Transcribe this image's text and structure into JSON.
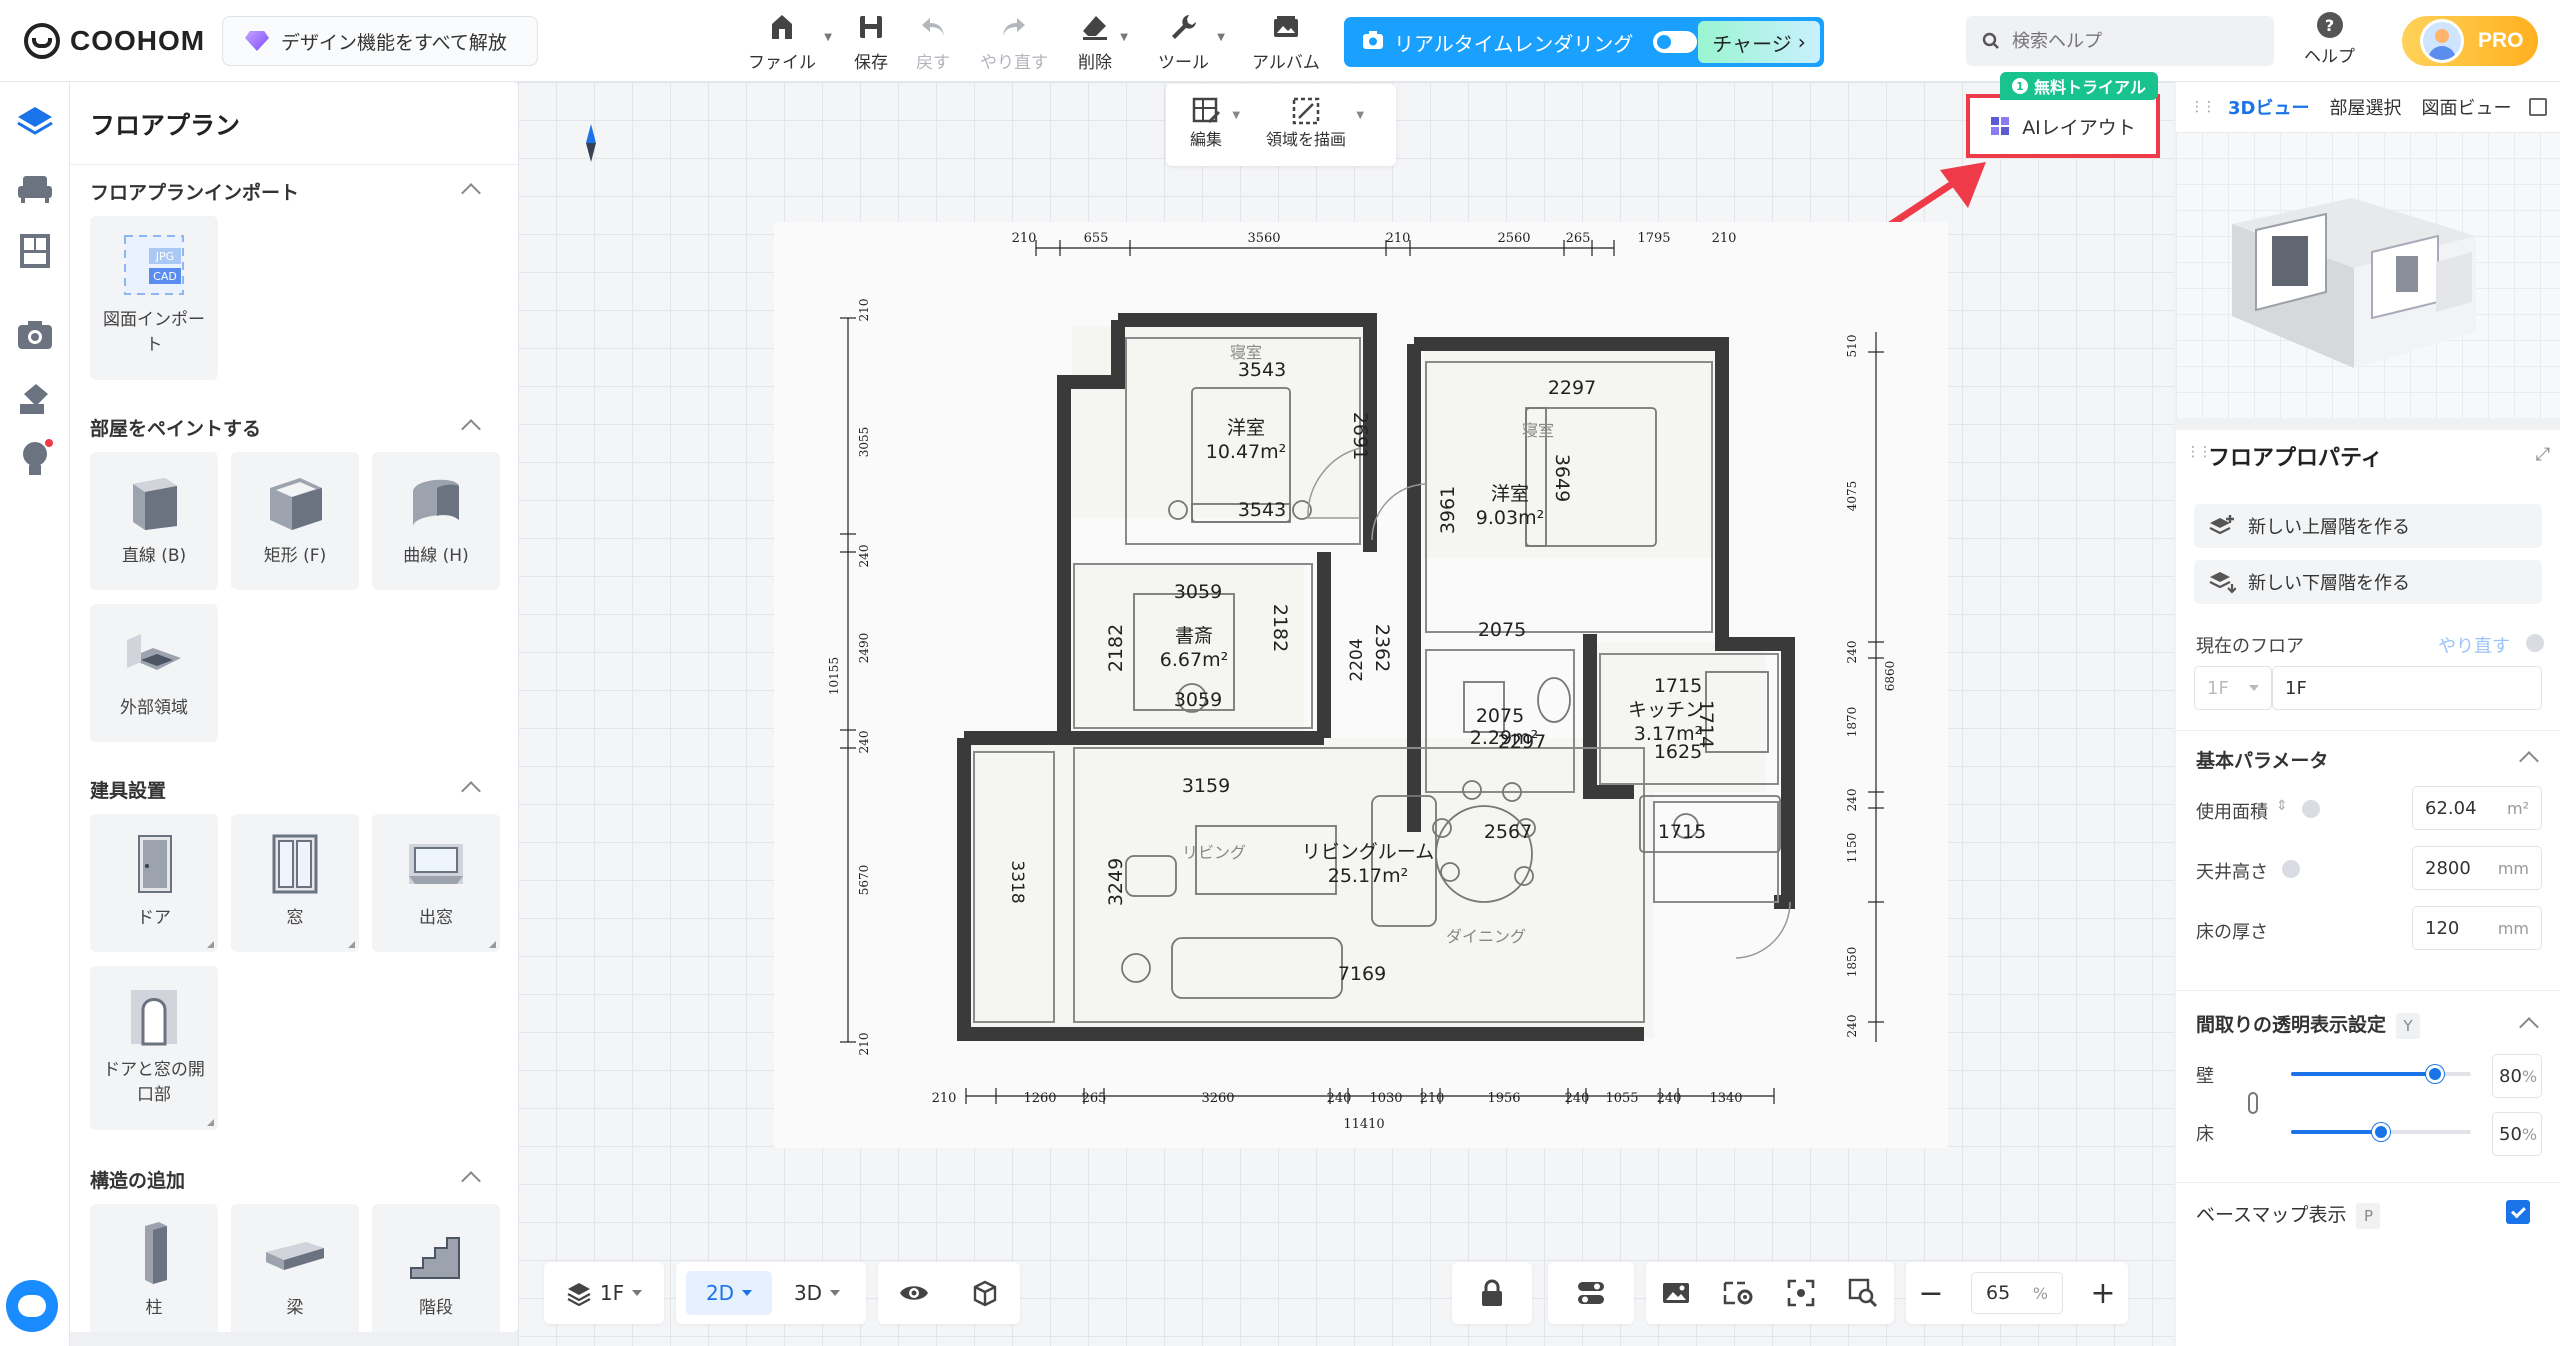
{
  "brand": {
    "name": "COOHOM",
    "unlock_label": "デザイン機能をすべて解放"
  },
  "toolbar": {
    "file": "ファイル",
    "save": "保存",
    "undo": "戻す",
    "redo": "やり直す",
    "delete": "削除",
    "tools": "ツール",
    "album": "アルバム",
    "render": "リアルタイムレンダリング",
    "charge": "チャージ"
  },
  "search": {
    "placeholder": "検索ヘルプ"
  },
  "help": {
    "label": "ヘルプ"
  },
  "account": {
    "badge": "PRO"
  },
  "left_panel": {
    "title": "フロアプラン",
    "import": {
      "title": "フロアプランインポート",
      "item": "図面インポート",
      "jpg": "JPG",
      "cad": "CAD"
    },
    "paint": {
      "title": "部屋をペイントする",
      "items": [
        "直線 (B)",
        "矩形 (F)",
        "曲線 (H)",
        "外部領域"
      ]
    },
    "fixtures": {
      "title": "建具設置",
      "items": [
        "ドア",
        "窓",
        "出窓",
        "ドアと窓の開口部"
      ]
    },
    "structure": {
      "title": "構造の追加",
      "items": [
        "柱",
        "梁",
        "階段"
      ]
    }
  },
  "canvas": {
    "edit_label": "編集",
    "draw_area_label": "領域を描画",
    "ai_layout": "AIレイアウト",
    "trial_badge": "無料トライアル",
    "trial_number": "1",
    "dims_top": [
      "210",
      "655",
      "3560",
      "210",
      "2560",
      "265",
      "1795",
      "210"
    ],
    "dims_bottom": [
      "210",
      "1260",
      "265",
      "3260",
      "240",
      "1030",
      "210",
      "1956",
      "240",
      "1055",
      "240",
      "1340"
    ],
    "dim_total": "11410",
    "dims_left": [
      "210",
      "3055",
      "240",
      "2490",
      "240",
      "5670",
      "210"
    ],
    "dim_left_total": "10155",
    "dims_right": [
      "510",
      "4075",
      "240",
      "1870",
      "240",
      "1150",
      "1850",
      "240"
    ],
    "dim_right_total": "6860",
    "rooms": [
      {
        "name": "洋室",
        "area": "10.47m²",
        "tag": "寝室"
      },
      {
        "name": "洋室",
        "area": "9.03m²",
        "tag": "寝室"
      },
      {
        "name": "書斎",
        "area": "6.67m²"
      },
      {
        "name": "キッチン",
        "area": "3.17m²"
      },
      {
        "name": "リビングルーム",
        "area": "25.17m²",
        "tag": "リビング"
      },
      {
        "tag": "ダイニング"
      },
      {
        "area": "2.29m²"
      }
    ],
    "inner_dims": [
      "3543",
      "2691",
      "3543",
      "2297",
      "3961",
      "3649",
      "3059",
      "2182",
      "2182",
      "3059",
      "2362",
      "2204",
      "2075",
      "2075",
      "2297",
      "1715",
      "1714",
      "1625",
      "3159",
      "2567",
      "1715",
      "3249",
      "3318",
      "7169"
    ]
  },
  "bottom_bar": {
    "floor": "1F",
    "mode_2d": "2D",
    "mode_3d": "3D",
    "zoom_value": "65",
    "zoom_unit": "%"
  },
  "right_panel": {
    "tabs": [
      "3Dビュー",
      "部屋選択",
      "図面ビュー"
    ],
    "props_title": "フロアプロパティ",
    "new_upper": "新しい上層階を作る",
    "new_lower": "新しい下層階を作る",
    "current_floor_label": "現在のフロア",
    "redo_link": "やり直す",
    "floor_prefix": "1F",
    "floor_value": "1F",
    "basic_params": "基本パラメータ",
    "usable_area_label": "使用面積",
    "usable_area_value": "62.04",
    "usable_area_unit": "m²",
    "ceiling_label": "天井高さ",
    "ceiling_value": "2800",
    "ceiling_unit": "mm",
    "floor_thick_label": "床の厚さ",
    "floor_thick_value": "120",
    "floor_thick_unit": "mm",
    "transparency_title": "間取りの透明表示設定",
    "transparency_key": "Y",
    "wall_label": "壁",
    "wall_value": "80",
    "wall_level": 0.8,
    "floor_label": "床",
    "floor_value_pct": "50",
    "floor_level": 0.5,
    "pct": "%",
    "basemap_label": "ベースマップ表示",
    "basemap_key": "P"
  },
  "colors": {
    "accent": "#1a73e8",
    "render": "#1aa0ff",
    "highlight": "#ef3a4a",
    "trial": "#19c38e",
    "pro": "#ffb01f"
  }
}
